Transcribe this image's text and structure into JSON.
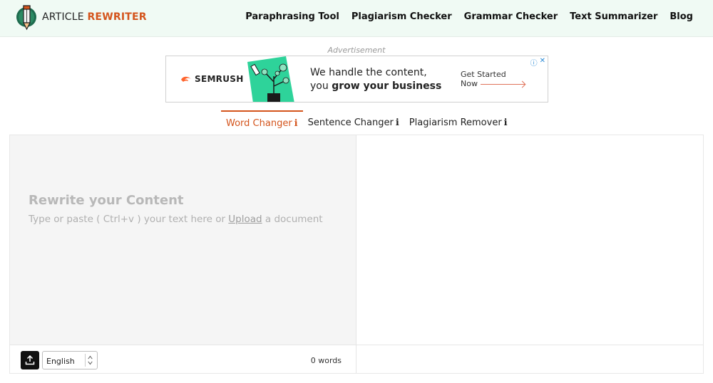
{
  "header": {
    "logo_prefix": "ARTICLE",
    "logo_accent": "REWRITER",
    "nav": [
      "Paraphrasing Tool",
      "Plagiarism Checker",
      "Grammar Checker",
      "Text Summarizer",
      "Blog"
    ]
  },
  "ad": {
    "label": "Advertisement",
    "brand": "SEMRUSH",
    "copy_line1": "We handle the content,",
    "copy_line2_plain": "you ",
    "copy_line2_bold": "grow your business",
    "cta_line1": "Get Started",
    "cta_line2": "Now"
  },
  "tabs": [
    {
      "label": "Word Changer",
      "info": "ℹ",
      "active": true
    },
    {
      "label": "Sentence Changer",
      "info": "ℹ",
      "active": false
    },
    {
      "label": "Plagiarism Remover",
      "info": "ℹ",
      "active": false
    }
  ],
  "editor": {
    "title": "Rewrite your Content",
    "hint_before": "Type or paste ( Ctrl+v ) your text here or ",
    "hint_link": "Upload",
    "hint_after": " a document",
    "language": "English",
    "word_count": "0 words"
  },
  "colors": {
    "accent": "#d4541c",
    "header_bg": "#f0faf4",
    "ad_green": "#2ed39a"
  }
}
